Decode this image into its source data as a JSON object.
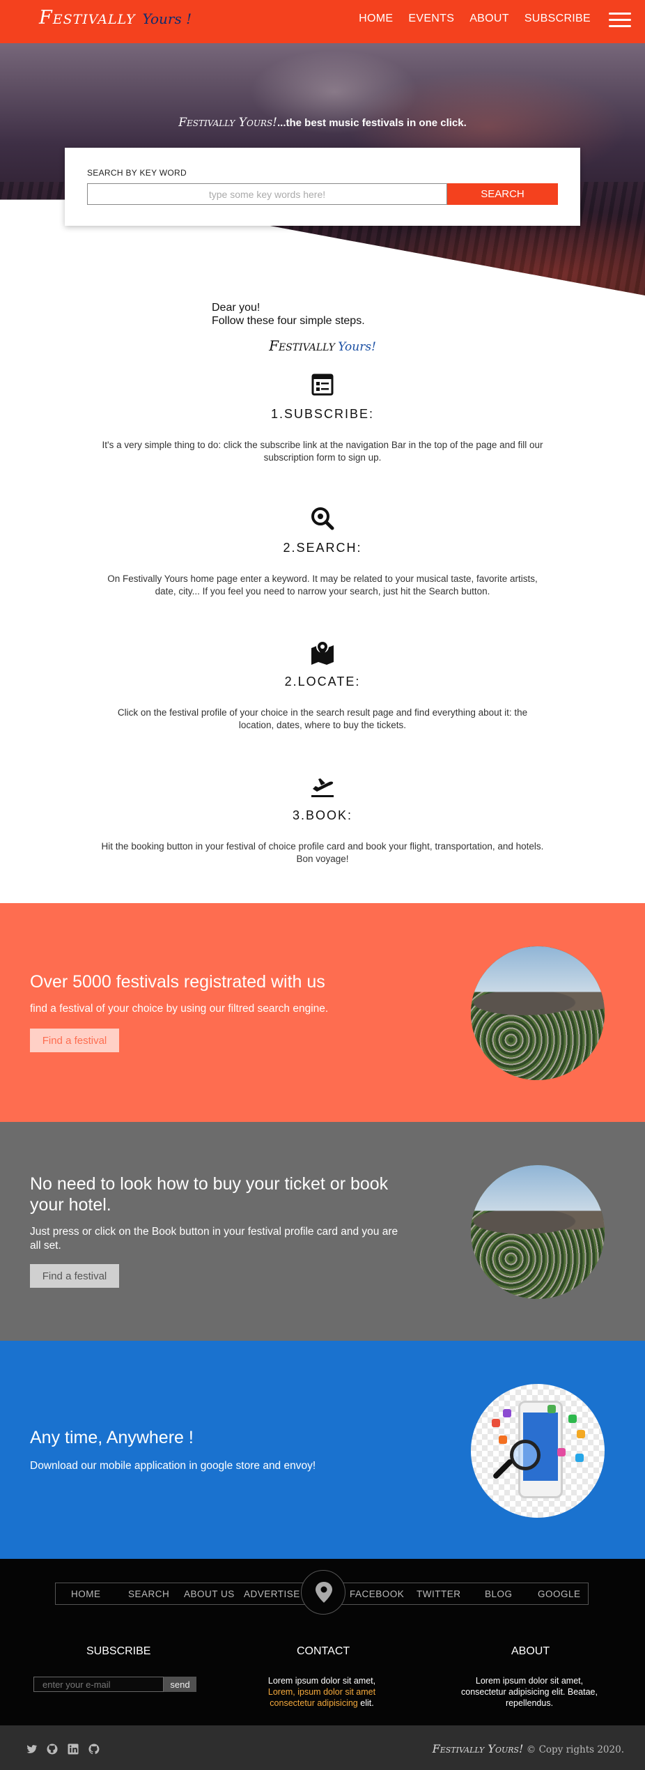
{
  "navbar": {
    "brand_main": "Festivally",
    "brand_sub": "Yours !",
    "links": [
      "HOME",
      "EVENTS",
      "ABOUT",
      "SUBSCRIBE"
    ]
  },
  "hero": {
    "tagline_brand": "Festivally Yours!",
    "tagline_rest": "...the best music festivals in one click.",
    "search_label": "SEARCH BY KEY WORD",
    "search_placeholder": "type some key words here!",
    "search_button": "SEARCH"
  },
  "steps_intro": {
    "line1": "Dear you!",
    "line2": "Follow these four simple steps.",
    "brand_main": "Festivally",
    "brand_sub": "Yours!"
  },
  "steps": [
    {
      "icon": "newspaper-icon",
      "title": "1.SUBSCRIBE:",
      "text": "It's a very simple thing to do: click the subscribe link at the navigation Bar in the top of the page and fill our subscription form to sign up."
    },
    {
      "icon": "search-magnifier-icon",
      "title": "2.SEARCH:",
      "text": "On Festivally Yours home page enter a keyword. It may be related to your musical taste, favorite artists, date, city... If you feel you need to narrow your search, just hit the Search button."
    },
    {
      "icon": "map-pin-icon",
      "title": "2.LOCATE:",
      "text": "Click on the festival profile of your choice in the search result page and find everything about it: the location, dates, where to buy the tickets."
    },
    {
      "icon": "airplane-takeoff-icon",
      "title": "3.BOOK:",
      "text": "Hit the booking button in your festival of choice profile card and book your flight, transportation, and hotels. Bon voyage!"
    }
  ],
  "band_festivals": {
    "title": "Over 5000 festivals registrated with us",
    "text": "find a festival of your choice by using our filtred search engine.",
    "button": "Find a festival",
    "color": "#fe6d50"
  },
  "band_tickets": {
    "title": "No need to look how to buy your ticket or book your hotel.",
    "text": "Just press or click on the Book button in your festival profile card and you are all set.",
    "button": "Find a festival",
    "color": "#6c6c6c"
  },
  "band_mobile": {
    "title": "Any time, Anywhere !",
    "text": "Download our mobile application in google store and envoy!",
    "color": "#1a72cf"
  },
  "footer": {
    "nav": [
      "HOME",
      "SEARCH",
      "ABOUT US",
      "ADVERTISE",
      "FACEBOOK",
      "TWITTER",
      "BLOG",
      "GOOGLE"
    ],
    "subscribe_title": "SUBSCRIBE",
    "email_placeholder": "enter your e-mail",
    "send_button": "send",
    "contact_title": "CONTACT",
    "contact_line1": "Lorem ipsum dolor sit amet,",
    "contact_line2": "Lorem, ipsum dolor sit amet",
    "contact_line3": "consectetur adipisicing",
    "contact_line3_end": "elit.",
    "about_title": "ABOUT",
    "about_text": "Lorem ipsum dolor sit amet, consectetur adipisicing elit. Beatae, repellendus.",
    "copyright_brand": "Festivally Yours!",
    "copyright_text": "© Copy rights 2020.",
    "social": [
      "twitter-icon",
      "github-circle-icon",
      "linkedin-icon",
      "github-icon"
    ]
  }
}
